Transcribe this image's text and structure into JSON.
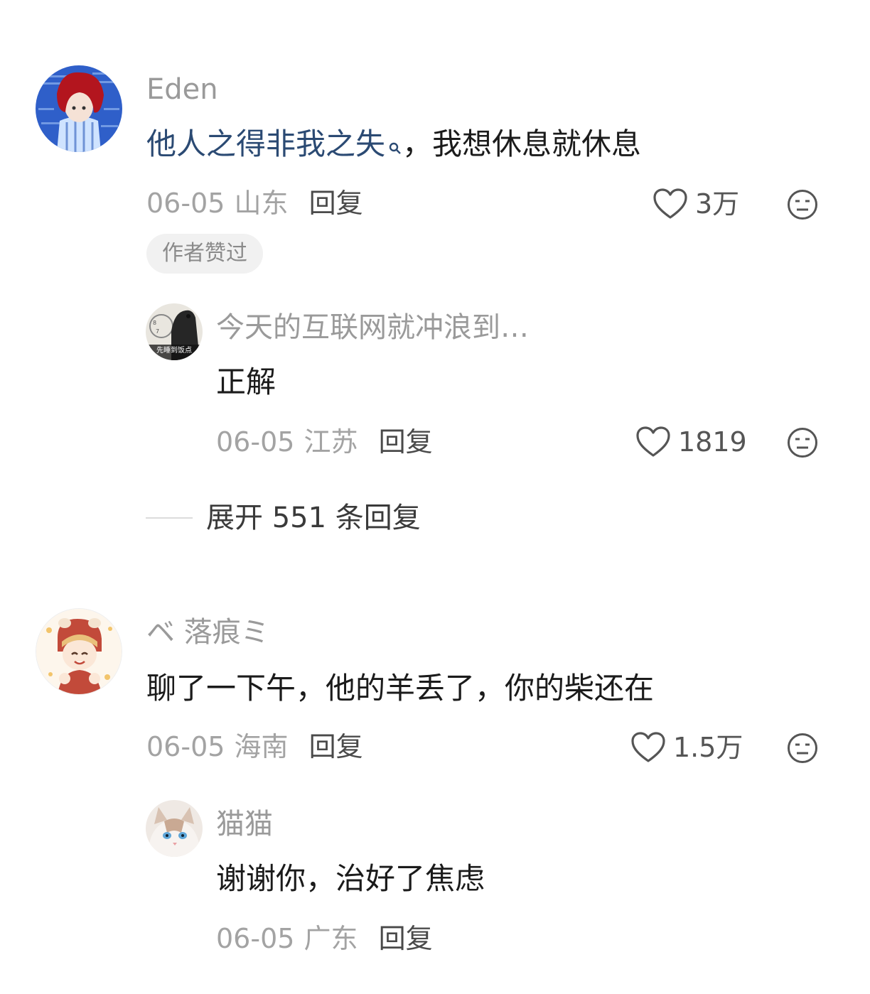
{
  "comments": [
    {
      "username": "Eden",
      "text_link": "他人之得非我之失",
      "text_rest": "，我想休息就休息",
      "date": "06-05",
      "location": "山东",
      "reply_label": "回复",
      "likes": "3万",
      "badge": "作者赞过",
      "sub_reply": {
        "username": "今天的互联网就冲浪到…",
        "avatar_caption": "先睡到饭点",
        "text": "正解",
        "date": "06-05",
        "location": "江苏",
        "reply_label": "回复",
        "likes": "1819"
      },
      "expand_label": "展开 551 条回复"
    },
    {
      "username": "ベ 落痕ミ",
      "text": "聊了一下午，他的羊丢了，你的柴还在",
      "date": "06-05",
      "location": "海南",
      "reply_label": "回复",
      "likes": "1.5万",
      "sub_reply": {
        "username": "猫猫",
        "text": "谢谢你，治好了焦虑",
        "date": "06-05",
        "location": "广东",
        "reply_label": "回复"
      }
    }
  ],
  "colors": {
    "link": "#2b4a73",
    "muted": "#a3a3a3",
    "text": "#1b1b1b"
  }
}
